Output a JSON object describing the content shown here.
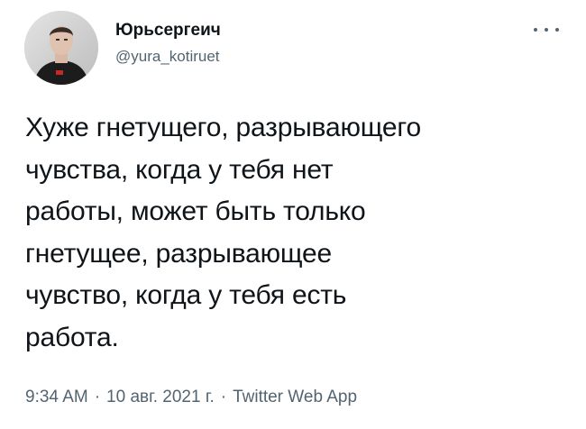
{
  "author": {
    "display_name": "Юрьсергеич",
    "handle": "@yura_kotiruet",
    "avatar_icon": "user-avatar-photo"
  },
  "more_icon": "more-dots-icon",
  "tweet": {
    "text": "Хуже гнетущего, разрывающего\nчувства, когда у тебя нет\nработы, может быть только\nгнетущее, разрывающее\nчувство, когда у тебя есть\nработа."
  },
  "meta": {
    "time": "9:34 AM",
    "separator": "·",
    "date": "10 авг. 2021 г.",
    "source": "Twitter Web App"
  },
  "colors": {
    "text": "#0f1419",
    "secondary": "#536471",
    "background": "#ffffff"
  }
}
